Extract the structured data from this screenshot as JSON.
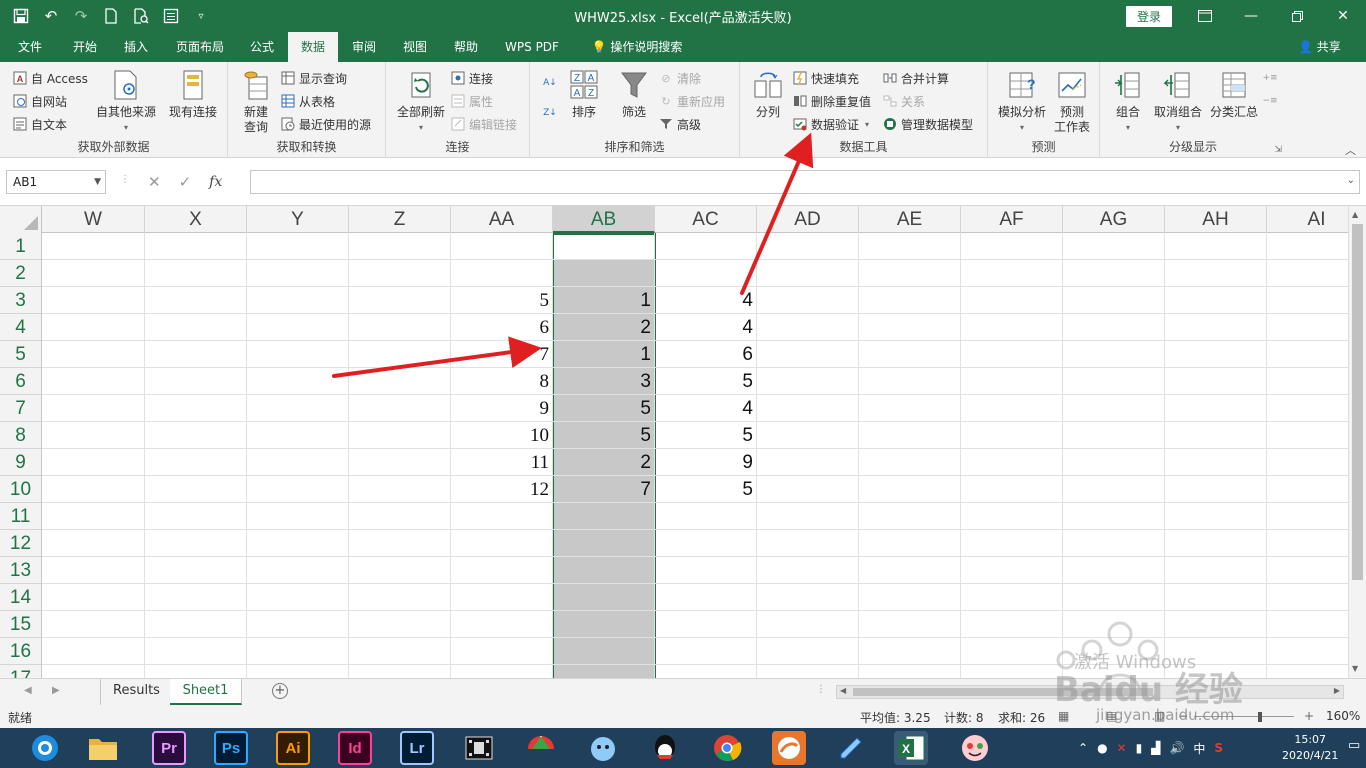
{
  "window": {
    "title": "WHW25.xlsx  -  Excel(产品激活失败)",
    "login_label": "登录",
    "controls": [
      "restore-window",
      "minimize",
      "maximize",
      "close"
    ]
  },
  "quick_access": [
    "save-icon",
    "undo-icon",
    "redo-icon",
    "new-icon",
    "print-preview-icon",
    "form-icon",
    "customize-icon"
  ],
  "tabs": [
    {
      "label": "文件"
    },
    {
      "label": "开始"
    },
    {
      "label": "插入"
    },
    {
      "label": "页面布局"
    },
    {
      "label": "公式"
    },
    {
      "label": "数据",
      "active": true
    },
    {
      "label": "审阅"
    },
    {
      "label": "视图"
    },
    {
      "label": "帮助"
    },
    {
      "label": "WPS PDF"
    },
    {
      "label": "操作说明搜索"
    }
  ],
  "share_label": "共享",
  "ribbon": {
    "external_data": {
      "label": "获取外部数据",
      "access": "自 Access",
      "web": "自网站",
      "text": "自文本",
      "other_sources": "自其他来源",
      "existing_connections": "现有连接"
    },
    "get_transform": {
      "label": "获取和转换",
      "new_query_line1": "新建",
      "new_query_line2": "查询",
      "show_queries": "显示查询",
      "from_table": "从表格",
      "recent_sources": "最近使用的源"
    },
    "connections": {
      "label": "连接",
      "refresh_all": "全部刷新",
      "connections": "连接",
      "properties": "属性",
      "edit_links": "编辑链接"
    },
    "sort_filter": {
      "label": "排序和筛选",
      "sort": "排序",
      "filter": "筛选",
      "clear": "清除",
      "reapply": "重新应用",
      "advanced": "高级"
    },
    "data_tools": {
      "label": "数据工具",
      "text_to_columns": "分列",
      "flash_fill": "快速填充",
      "remove_duplicates": "删除重复值",
      "data_validation": "数据验证",
      "consolidate": "合并计算",
      "relationships": "关系",
      "data_model": "管理数据模型"
    },
    "forecast": {
      "label": "预测",
      "what_if": "模拟分析",
      "forecast_sheet_line1": "预测",
      "forecast_sheet_line2": "工作表"
    },
    "outline": {
      "label": "分级显示",
      "group": "组合",
      "ungroup": "取消组合",
      "subtotal": "分类汇总"
    }
  },
  "formula_bar": {
    "name_box": "AB1",
    "formula": ""
  },
  "columns": [
    "W",
    "X",
    "Y",
    "Z",
    "AA",
    "AB",
    "AC",
    "AD",
    "AE",
    "AF",
    "AG",
    "AH",
    "AI"
  ],
  "selected_column": "AB",
  "rows": [
    "1",
    "2",
    "3",
    "4",
    "5",
    "6",
    "7",
    "8",
    "9",
    "10",
    "11",
    "12",
    "13",
    "14",
    "15",
    "16",
    "17"
  ],
  "cells": {
    "AA": [
      "",
      "",
      "5",
      "6",
      "7",
      "8",
      "9",
      "10",
      "11",
      "12"
    ],
    "AB": [
      "",
      "",
      "1",
      "2",
      "1",
      "3",
      "5",
      "5",
      "2",
      "7"
    ],
    "AC": [
      "",
      "",
      "4",
      "4",
      "6",
      "5",
      "4",
      "5",
      "9",
      "5"
    ]
  },
  "sheets": [
    {
      "label": "Results"
    },
    {
      "label": "Sheet1",
      "active": true
    }
  ],
  "status": {
    "mode": "就绪",
    "average": "平均值: 3.25",
    "count": "计数: 8",
    "sum": "求和: 26",
    "zoom": "160%"
  },
  "taskbar": {
    "apps": [
      "Pr",
      "Ps",
      "Ai",
      "Id",
      "Lr"
    ],
    "ime": "中",
    "time": "15:07",
    "date": "2020/4/21"
  },
  "watermark": {
    "activate": "激活 Windows",
    "brand": "Baidu 经验",
    "site": "jingyan.baidu.com"
  },
  "colors": {
    "excel_green": "#217346",
    "arrow_red": "#e02020"
  }
}
